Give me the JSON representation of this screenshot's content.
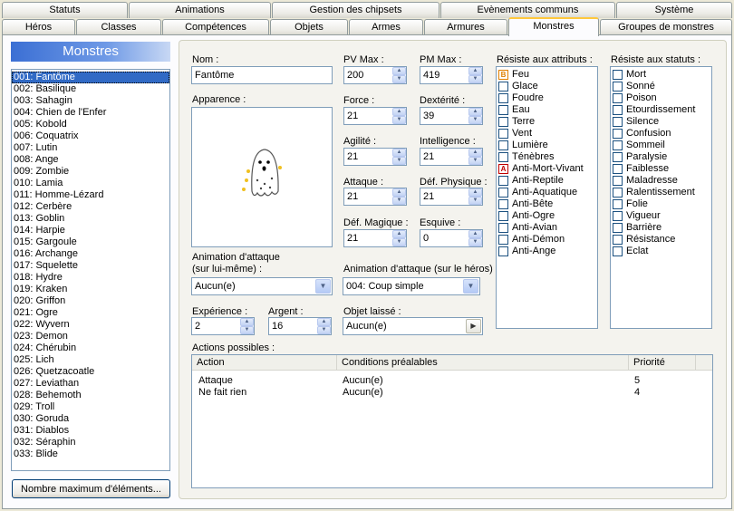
{
  "tabs_row1": [
    "Statuts",
    "Animations",
    "Gestion des chipsets",
    "Evènements communs",
    "Système"
  ],
  "tabs_row2": [
    "Héros",
    "Classes",
    "Compétences",
    "Objets",
    "Armes",
    "Armures",
    "Monstres",
    "Groupes de monstres"
  ],
  "active_tab": "Monstres",
  "list": {
    "title": "Monstres",
    "selected_index": 0,
    "items": [
      "001: Fantôme",
      "002: Basilique",
      "003: Sahagin",
      "004: Chien de l'Enfer",
      "005: Kobold",
      "006: Coquatrix",
      "007: Lutin",
      "008: Ange",
      "009: Zombie",
      "010: Lamia",
      "011: Homme-Lézard",
      "012: Cerbère",
      "013: Goblin",
      "014: Harpie",
      "015: Gargoule",
      "016: Archange",
      "017: Squelette",
      "018: Hydre",
      "019: Kraken",
      "020: Griffon",
      "021: Ogre",
      "022: Wyvern",
      "023: Demon",
      "024: Chérubin",
      "025: Lich",
      "026: Quetzacoatle",
      "027: Leviathan",
      "028: Behemoth",
      "029: Troll",
      "030: Goruda",
      "031: Diablos",
      "032: Séraphin",
      "033: Blide"
    ],
    "max_button": "Nombre maximum d'éléments..."
  },
  "form": {
    "name_label": "Nom :",
    "name_value": "Fantôme",
    "appearance_label": "Apparence :",
    "stats": {
      "pv_label": "PV Max :",
      "pv": "200",
      "pm_label": "PM Max :",
      "pm": "419",
      "force_label": "Force :",
      "force": "21",
      "dex_label": "Dextérité :",
      "dex": "39",
      "agi_label": "Agilité :",
      "agi": "21",
      "int_label": "Intelligence :",
      "int": "21",
      "atk_label": "Attaque :",
      "atk": "21",
      "defp_label": "Déf. Physique :",
      "defp": "21",
      "defm_label": "Déf. Magique :",
      "defm": "21",
      "esq_label": "Esquive :",
      "esq": "0"
    },
    "anim_self_label1": "Animation d'attaque",
    "anim_self_label2": "(sur lui-même) :",
    "anim_self_value": "Aucun(e)",
    "anim_hero_label": "Animation d'attaque (sur le héros) :",
    "anim_hero_value": "004: Coup simple",
    "exp_label": "Expérience :",
    "exp": "2",
    "money_label": "Argent :",
    "money": "16",
    "item_label": "Objet laissé :",
    "item_value": "Aucun(e)",
    "actions_label": "Actions possibles :"
  },
  "attributes": {
    "label": "Résiste aux attributs :",
    "items": [
      {
        "name": "Feu",
        "mark": "B"
      },
      {
        "name": "Glace",
        "mark": ""
      },
      {
        "name": "Foudre",
        "mark": ""
      },
      {
        "name": "Eau",
        "mark": ""
      },
      {
        "name": "Terre",
        "mark": ""
      },
      {
        "name": "Vent",
        "mark": ""
      },
      {
        "name": "Lumière",
        "mark": ""
      },
      {
        "name": "Ténèbres",
        "mark": ""
      },
      {
        "name": "Anti-Mort-Vivant",
        "mark": "A"
      },
      {
        "name": "Anti-Reptile",
        "mark": ""
      },
      {
        "name": "Anti-Aquatique",
        "mark": ""
      },
      {
        "name": "Anti-Bête",
        "mark": ""
      },
      {
        "name": "Anti-Ogre",
        "mark": ""
      },
      {
        "name": "Anti-Avian",
        "mark": ""
      },
      {
        "name": "Anti-Démon",
        "mark": ""
      },
      {
        "name": "Anti-Ange",
        "mark": ""
      }
    ],
    "mark_colors": {
      "A": "#c00000",
      "B": "#e08000"
    }
  },
  "statuses": {
    "label": "Résiste aux statuts :",
    "items": [
      "Mort",
      "Sonné",
      "Poison",
      "Etourdissement",
      "Silence",
      "Confusion",
      "Sommeil",
      "Paralysie",
      "Faiblesse",
      "Maladresse",
      "Ralentissement",
      "Folie",
      "Vigueur",
      "Barrière",
      "Résistance",
      "Eclat"
    ]
  },
  "actions": {
    "headers": [
      "Action",
      "Conditions préalables",
      "Priorité"
    ],
    "rows": [
      {
        "action": "Attaque",
        "condition": "Aucun(e)",
        "priority": "5"
      },
      {
        "action": "Ne fait rien",
        "condition": "Aucun(e)",
        "priority": "4"
      }
    ]
  },
  "colors": {
    "selection": "#316ac5",
    "accent_tab": "#ffc83c"
  }
}
